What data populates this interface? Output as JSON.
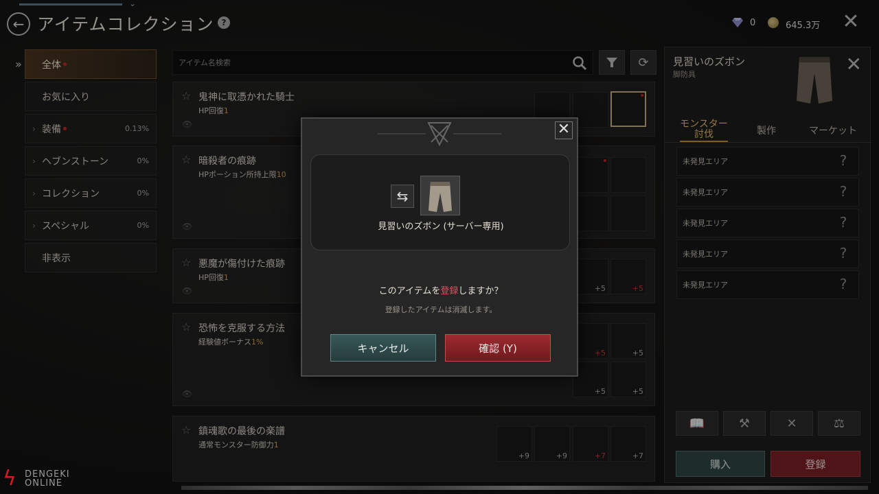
{
  "header": {
    "title": "アイテムコレクション",
    "help_icon": "?",
    "gem_count": "0",
    "gold_amount": "645.3万"
  },
  "sidebar": {
    "items": [
      {
        "label": "全体",
        "pct": "",
        "has_dot": true,
        "active": true
      },
      {
        "label": "お気に入り",
        "pct": ""
      },
      {
        "label": "装備",
        "pct": "0.13%",
        "has_dot": true,
        "caret": true
      },
      {
        "label": "ヘブンストーン",
        "pct": "0%",
        "caret": true
      },
      {
        "label": "コレクション",
        "pct": "0%",
        "caret": true
      },
      {
        "label": "スペシャル",
        "pct": "0%",
        "caret": true
      },
      {
        "label": "非表示",
        "pct": ""
      }
    ]
  },
  "search": {
    "placeholder": "アイテム名検索"
  },
  "collections": [
    {
      "title": "鬼神に取憑かれた騎士",
      "effect": "HP回復",
      "value": "1"
    },
    {
      "title": "暗殺者の痕跡",
      "effect": "HPポーション所持上限",
      "value": "10"
    },
    {
      "title": "悪魔が傷付けた痕跡",
      "effect": "HP回復",
      "value": "1"
    },
    {
      "title": "恐怖を克服する方法",
      "effect": "経験値ボーナス",
      "value": "1%"
    },
    {
      "title": "鎮魂歌の最後の楽譜",
      "effect": "通常モンスター防御力",
      "value": "1"
    }
  ],
  "slot_plus": {
    "p5": "+5",
    "p7": "+7",
    "p9": "+9"
  },
  "detail": {
    "name": "見習いのズボン",
    "type": "脚防具",
    "tabs": [
      "モンスター討伐",
      "製作",
      "マーケット"
    ],
    "areas": [
      "未発見エリア",
      "未発見エリア",
      "未発見エリア",
      "未発見エリア",
      "未発見エリア"
    ],
    "buy_label": "購入",
    "register_label": "登録"
  },
  "modal": {
    "item_name": "見習いのズボン (サーバー専用)",
    "question_pre": "このアイテムを",
    "question_red": "登録",
    "question_post": "しますか？",
    "note": "登録したアイテムは消滅します。",
    "cancel_label": "キャンセル",
    "confirm_label": "確認 (Y)"
  },
  "watermark": {
    "line1": "DENGEKI",
    "line2": "ONLINE"
  },
  "colors": {
    "accent_gold": "#d6a24a",
    "confirm_red": "#9e2a30",
    "cancel_teal": "#375858"
  }
}
